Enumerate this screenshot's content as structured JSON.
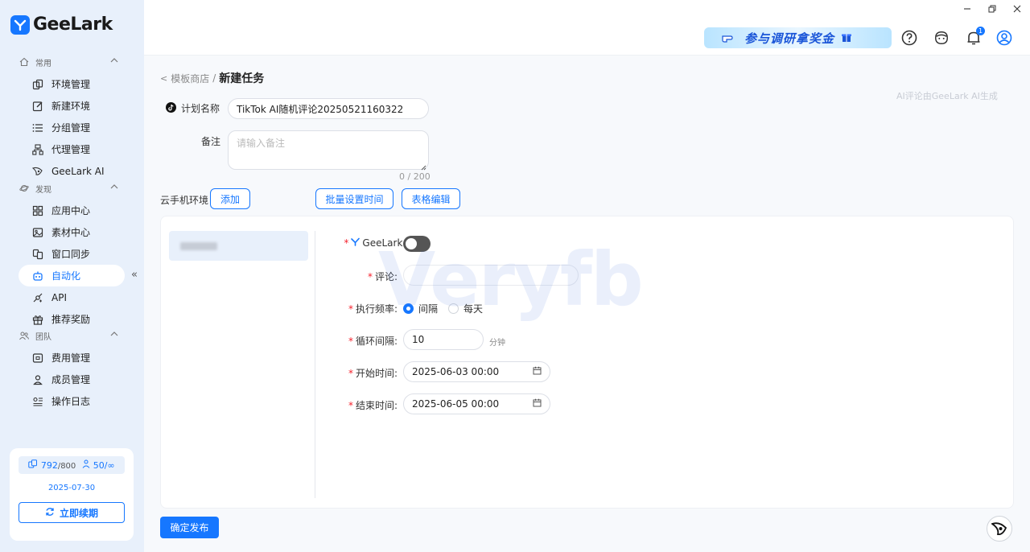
{
  "app": {
    "name": "GeeLark"
  },
  "sidebar": {
    "groups": [
      {
        "label": "常用",
        "items": [
          {
            "label": "环境管理",
            "icon": "environment-icon"
          },
          {
            "label": "新建环境",
            "icon": "edit-icon"
          },
          {
            "label": "分组管理",
            "icon": "list-icon"
          },
          {
            "label": "代理管理",
            "icon": "proxy-icon"
          },
          {
            "label": "GeeLark AI",
            "icon": "ai-icon"
          }
        ]
      },
      {
        "label": "发现",
        "items": [
          {
            "label": "应用中心",
            "icon": "grid-icon"
          },
          {
            "label": "素材中心",
            "icon": "image-icon"
          },
          {
            "label": "窗口同步",
            "icon": "sync-icon"
          },
          {
            "label": "自动化",
            "icon": "robot-icon",
            "active": true
          },
          {
            "label": "API",
            "icon": "api-icon"
          },
          {
            "label": "推荐奖励",
            "icon": "gift-icon"
          }
        ]
      },
      {
        "label": "团队",
        "items": [
          {
            "label": "费用管理",
            "icon": "wallet-icon"
          },
          {
            "label": "成员管理",
            "icon": "user-icon"
          },
          {
            "label": "操作日志",
            "icon": "log-icon"
          }
        ]
      }
    ],
    "quota": {
      "devices_used": "792",
      "devices_total": "/800",
      "members_used": "50/",
      "members_total": "∞",
      "expire_date": "2025-07-30",
      "renew_label": "立即续期"
    }
  },
  "topbar": {
    "banner_text": "参与调研拿奖金",
    "notification_count": "1"
  },
  "page": {
    "breadcrumb_back": "<",
    "breadcrumb_parent": "模板商店",
    "breadcrumb_sep": "/",
    "title": "新建任务",
    "ai_note": "AI评论由GeeLark AI生成",
    "plan_name_label": "计划名称",
    "plan_name_value": "TikTok AI随机评论20250521160322",
    "remark_label": "备注",
    "remark_placeholder": "请输入备注",
    "remark_counter": "0 / 200",
    "env_label": "云手机环境",
    "add_label": "添加",
    "batch_time_label": "批量设置时间",
    "table_edit_label": "表格编辑",
    "submit_label": "确定发布"
  },
  "task_form": {
    "geelark_ai_label": "GeeLark AI:",
    "comment_label": "评论:",
    "frequency_label": "执行频率:",
    "frequency_options": [
      "间隔",
      "每天"
    ],
    "interval_label": "循环间隔:",
    "interval_value": "10",
    "interval_unit": "分钟",
    "start_label": "开始时间:",
    "start_value": "2025-06-03 00:00",
    "end_label": "结束时间:",
    "end_value": "2025-06-05 00:00"
  },
  "watermark": "Veryfb"
}
